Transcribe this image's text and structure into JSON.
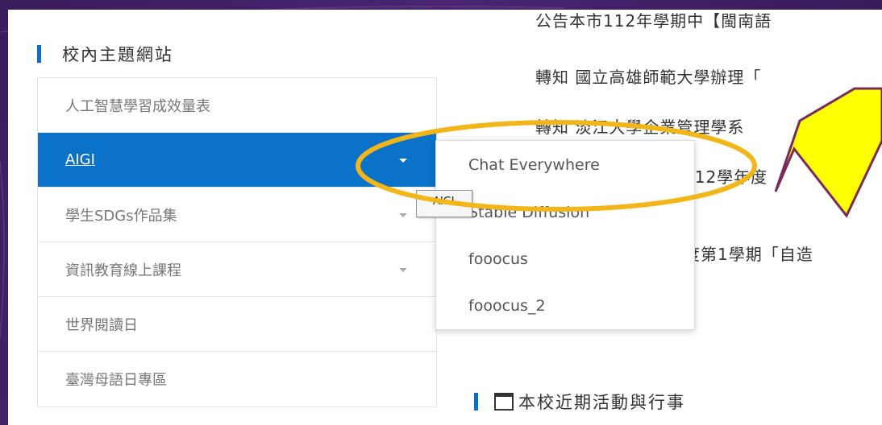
{
  "sidebar": {
    "title": "校內主題網站",
    "items": [
      {
        "label": "人工智慧學習成效量表",
        "has_caret": false,
        "active": false
      },
      {
        "label": "AIGI",
        "has_caret": true,
        "active": true
      },
      {
        "label": "學生SDGs作品集",
        "has_caret": true,
        "active": false
      },
      {
        "label": "資訊教育線上課程",
        "has_caret": true,
        "active": false
      },
      {
        "label": "世界閱讀日",
        "has_caret": false,
        "active": false
      },
      {
        "label": "臺灣母語日專區",
        "has_caret": false,
        "active": false
      }
    ]
  },
  "tooltip": {
    "text": "AIGI"
  },
  "dropdown": {
    "items": [
      {
        "label": "Chat Everywhere"
      },
      {
        "label": "Stable Diffusion"
      },
      {
        "label": "fooocus"
      },
      {
        "label": "fooocus_2"
      }
    ]
  },
  "announcements": [
    "公告本市112年學期中【閩南語",
    "轉知 國立高雄師範大學辦理「",
    "轉知 淡江大學企業管理學系",
    "112學年度",
    "度第1學期「自造"
  ],
  "section2": {
    "title": "本校近期活動與行事"
  },
  "annotation": {
    "highlight_color": "#f2b619",
    "arrow_fill": "#ffff00",
    "arrow_stroke": "#7a2a5a"
  }
}
